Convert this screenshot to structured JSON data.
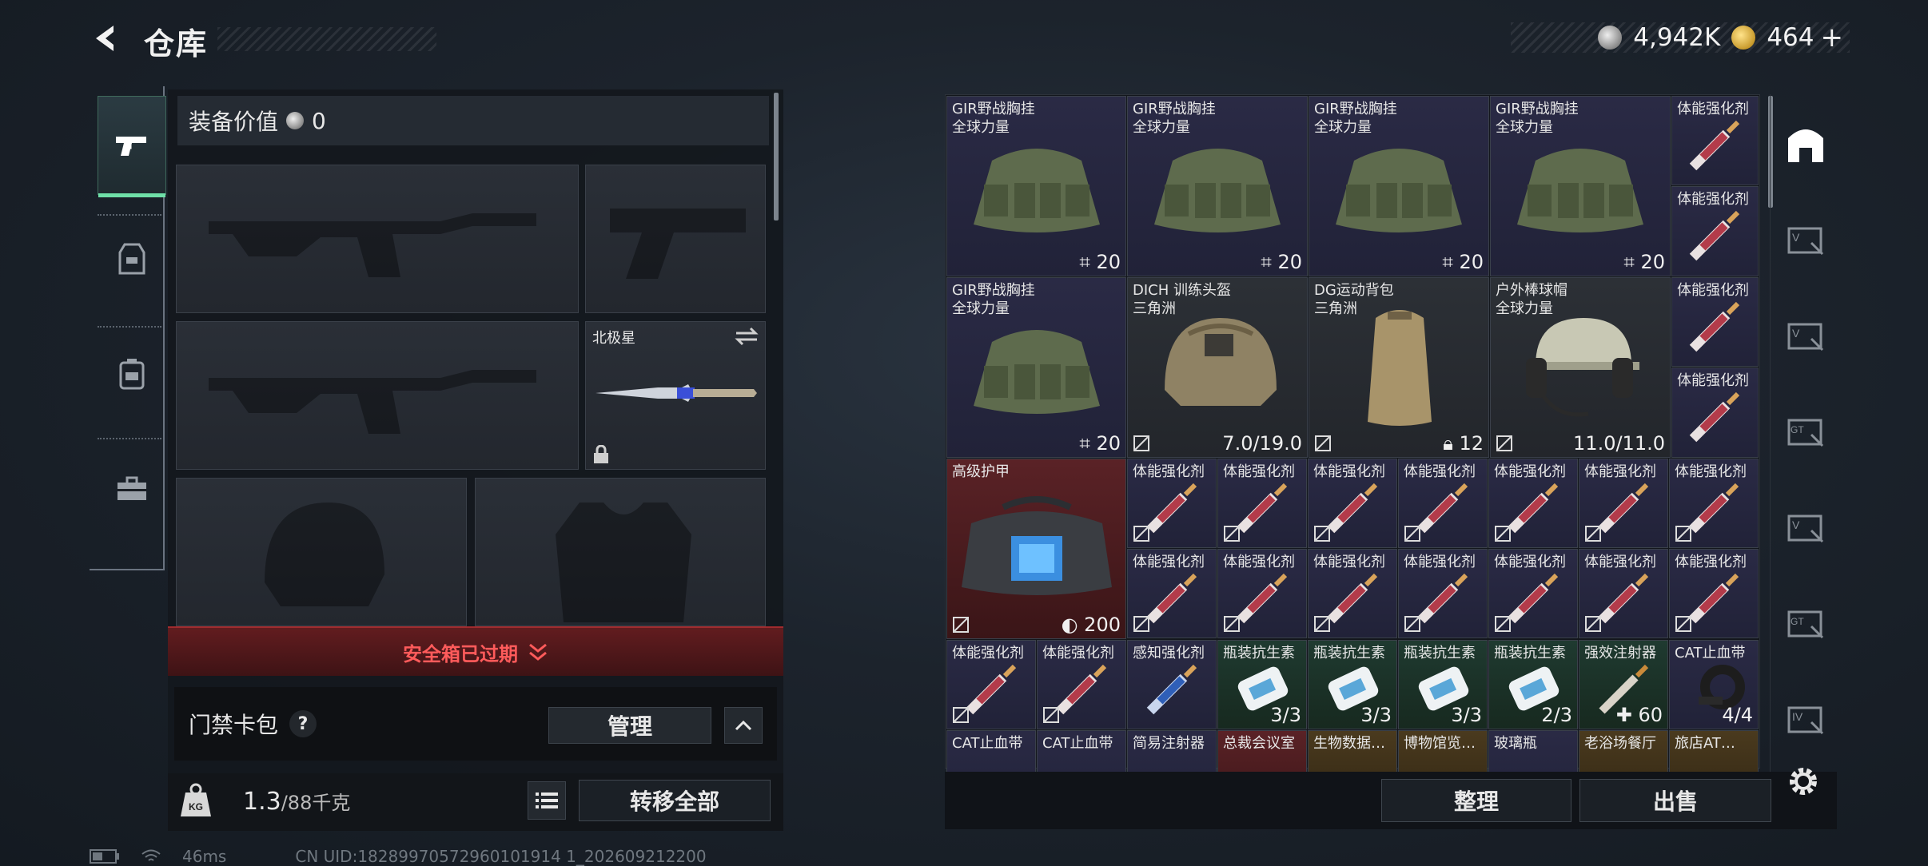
{
  "header": {
    "title": "仓库",
    "silver_amount": "4,942K",
    "gold_amount": "464",
    "gold_plus": "+"
  },
  "left": {
    "equip_value_label": "装备价值",
    "equip_value": "0",
    "melee_slot_name": "北极星",
    "safebox_status": "安全箱已过期",
    "keycard_label": "门禁卡包",
    "keycard_help": "?",
    "manage_button": "管理",
    "weight_current": "1.3",
    "weight_max": "/88千克",
    "transfer_all_button": "转移全部"
  },
  "status": {
    "ping": "46ms",
    "uid": "CN UID:18289970572960101914 1_202609212200"
  },
  "items": [
    {
      "name": "GIR野战胸挂\n全球力量",
      "count": "20",
      "icon": "chest-rig"
    },
    {
      "name": "GIR野战胸挂\n全球力量",
      "count": "20",
      "icon": "chest-rig"
    },
    {
      "name": "GIR野战胸挂\n全球力量",
      "count": "20",
      "icon": "chest-rig"
    },
    {
      "name": "GIR野战胸挂\n全球力量",
      "count": "20",
      "icon": "chest-rig"
    },
    {
      "name": "体能强化剂",
      "count": "",
      "icon": "syringe"
    },
    {
      "name": "体能强化剂",
      "count": "",
      "icon": "syringe"
    },
    {
      "name": "GIR野战胸挂\n全球力量",
      "count": "20",
      "icon": "chest-rig"
    },
    {
      "name": "DICH 训练头盔\n三角洲",
      "count": "7.0/19.0",
      "icon": "helmet"
    },
    {
      "name": "DG运动背包\n三角洲",
      "count": "12",
      "icon": "backpack"
    },
    {
      "name": "户外棒球帽\n全球力量",
      "count": "11.0/11.0",
      "icon": "headset-cap"
    },
    {
      "name": "体能强化剂",
      "count": "",
      "icon": "syringe"
    },
    {
      "name": "体能强化剂",
      "count": "",
      "icon": "syringe"
    },
    {
      "name": "高级护甲",
      "count": "200",
      "icon": "armor-bag"
    },
    {
      "name": "体能强化剂",
      "count": "",
      "icon": "syringe"
    },
    {
      "name": "瓶装抗生素",
      "count": "3/3",
      "icon": "pill-bottle"
    },
    {
      "name": "强效注射器",
      "count": "60",
      "icon": "injector"
    },
    {
      "name": "CAT止血带",
      "count": "4/4",
      "icon": "tourniquet"
    },
    {
      "name": "感知强化剂",
      "count": "",
      "icon": "blue-syringe"
    },
    {
      "name": "瓶装抗生素",
      "count": "2/3",
      "icon": "pill-bottle"
    },
    {
      "name": "CAT止血带",
      "count": "",
      "icon": "tourniquet"
    },
    {
      "name": "简易注射器",
      "count": "",
      "icon": "injector"
    },
    {
      "name": "总裁会议室",
      "count": "",
      "icon": "keycard"
    },
    {
      "name": "生物数据…",
      "count": "",
      "icon": "document"
    },
    {
      "name": "博物馆览…",
      "count": "",
      "icon": "document"
    },
    {
      "name": "玻璃瓶",
      "count": "",
      "icon": "document"
    },
    {
      "name": "老浴场餐厅",
      "count": "",
      "icon": "keycard"
    },
    {
      "name": "旅店AT…",
      "count": "",
      "icon": "keycard"
    }
  ],
  "bottom": {
    "sort_button": "整理",
    "sell_button": "出售"
  }
}
